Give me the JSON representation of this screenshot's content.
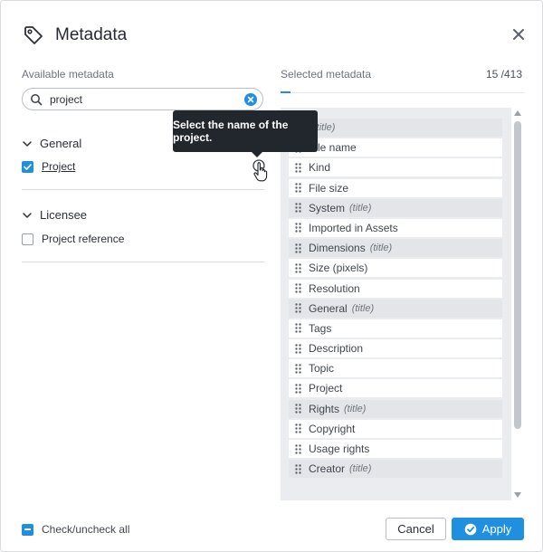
{
  "dialog": {
    "title": "Metadata",
    "available_label": "Available metadata",
    "selected_label": "Selected metadata",
    "selected_count": "15 /413"
  },
  "search": {
    "value": "project"
  },
  "available_groups": [
    {
      "name": "General",
      "items": [
        {
          "label": "Project",
          "checked": true
        }
      ]
    },
    {
      "name": "Licensee",
      "items": [
        {
          "label": "Project reference",
          "checked": false
        }
      ]
    }
  ],
  "tooltip": {
    "text": "Select the name of the project."
  },
  "selected_list": [
    {
      "label": "",
      "sub": "(title)",
      "is_title": true
    },
    {
      "label": "File name",
      "is_title": false
    },
    {
      "label": "Kind",
      "is_title": false
    },
    {
      "label": "File size",
      "is_title": false
    },
    {
      "label": "System",
      "sub": "(title)",
      "is_title": true
    },
    {
      "label": "Imported in Assets",
      "is_title": false
    },
    {
      "label": "Dimensions",
      "sub": "(title)",
      "is_title": true
    },
    {
      "label": "Size (pixels)",
      "is_title": false
    },
    {
      "label": "Resolution",
      "is_title": false
    },
    {
      "label": "General",
      "sub": "(title)",
      "is_title": true
    },
    {
      "label": "Tags",
      "is_title": false
    },
    {
      "label": "Description",
      "is_title": false
    },
    {
      "label": "Topic",
      "is_title": false
    },
    {
      "label": "Project",
      "is_title": false
    },
    {
      "label": "Rights",
      "sub": "(title)",
      "is_title": true
    },
    {
      "label": "Copyright",
      "is_title": false
    },
    {
      "label": "Usage rights",
      "is_title": false
    },
    {
      "label": "Creator",
      "sub": "(title)",
      "is_title": true
    }
  ],
  "footer": {
    "check_all_label": "Check/uncheck all",
    "cancel_label": "Cancel",
    "apply_label": "Apply"
  },
  "colors": {
    "accent": "#1f8fe0",
    "tooltip_bg": "#22262d",
    "list_bg": "#eaecef"
  },
  "icons": {
    "header": "tag-icon",
    "close": "close-icon",
    "search": "search-icon",
    "clear": "clear-icon",
    "group_toggle": "chevron-down-icon",
    "info": "info-icon",
    "cursor": "hand-pointer-icon",
    "drag": "drag-handle-icon",
    "apply": "check-circle-icon"
  }
}
